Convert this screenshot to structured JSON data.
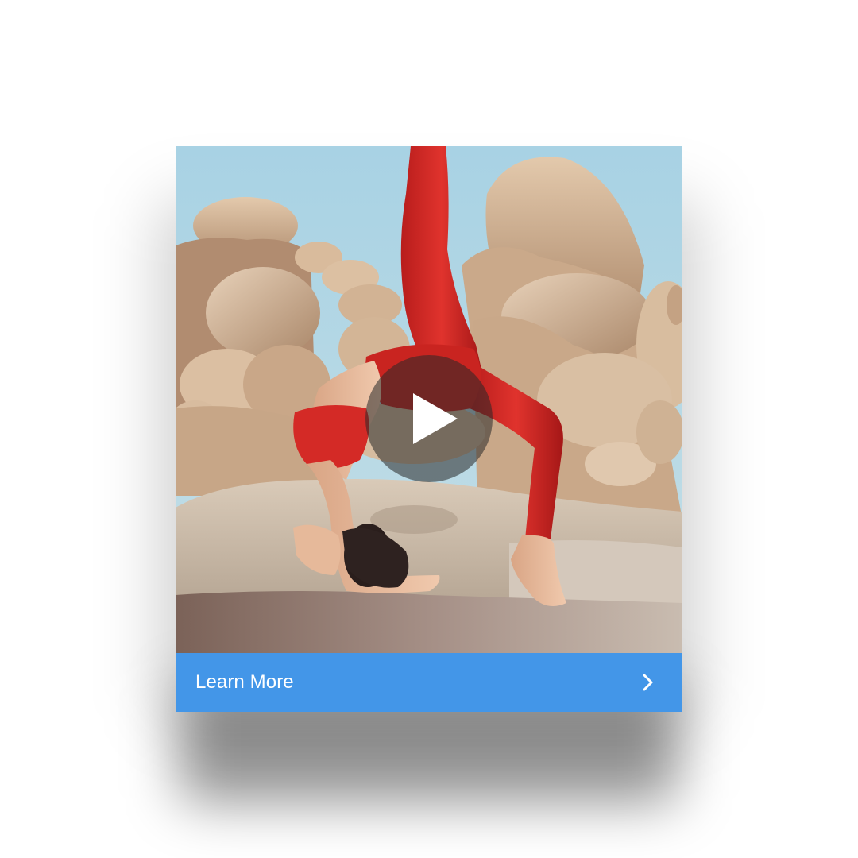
{
  "ad_card": {
    "media": {
      "description_icon": "play-icon",
      "play_button_label": ""
    },
    "cta": {
      "label": "Learn More",
      "icon": "chevron-right-icon"
    }
  },
  "colors": {
    "cta_background": "#4396e8",
    "cta_text": "#ffffff",
    "sky": "#a9d3e4",
    "outfit": "#d42a26",
    "rock": "#d6b89a"
  }
}
